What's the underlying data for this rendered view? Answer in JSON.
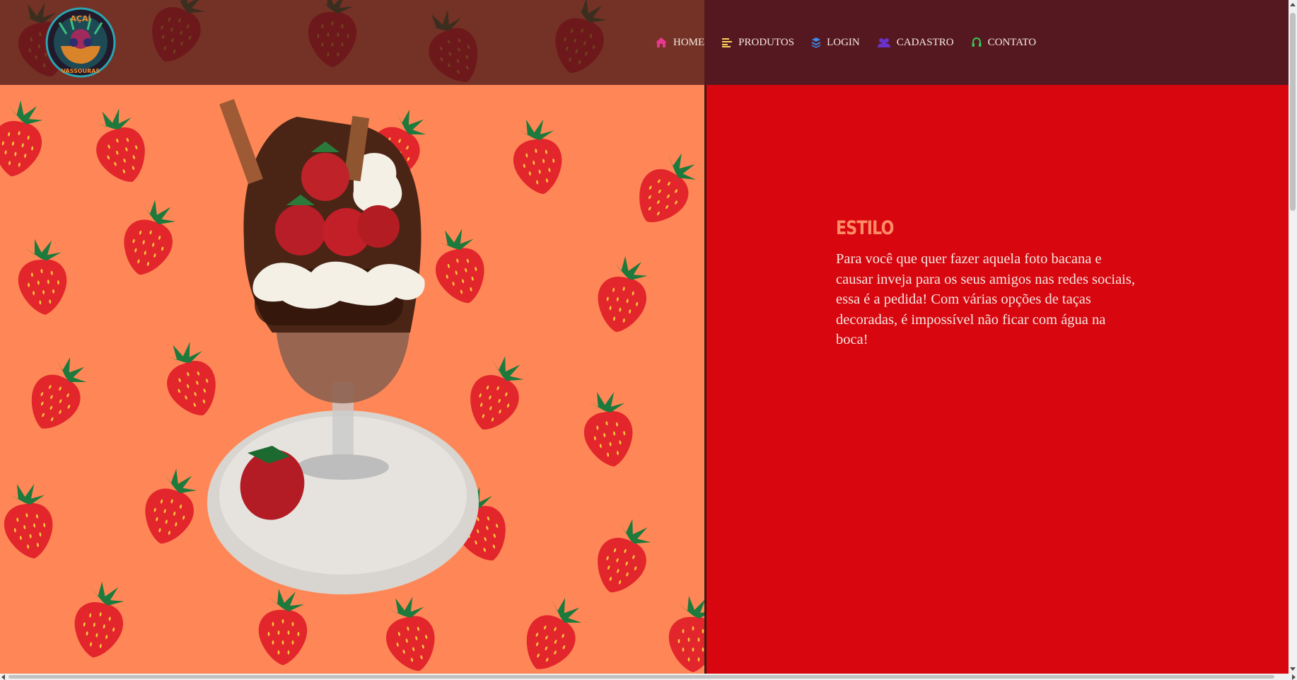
{
  "brand": {
    "logo_icon": "acai-bowl-logo",
    "logo_top_text": "AÇAÍ",
    "logo_bottom_text": "VASSOURAS"
  },
  "nav": {
    "items": [
      {
        "label": "HOME",
        "icon": "home-icon",
        "icon_color": "#e8378c"
      },
      {
        "label": "PRODUTOS",
        "icon": "list-icon",
        "icon_color": "#f4d35e"
      },
      {
        "label": "LOGIN",
        "icon": "layers-icon",
        "icon_color": "#3a8df0"
      },
      {
        "label": "CADASTRO",
        "icon": "users-icon",
        "icon_color": "#6a32c8"
      },
      {
        "label": "CONTATO",
        "icon": "headset-icon",
        "icon_color": "#34c759"
      }
    ]
  },
  "hero": {
    "image": "chocolate-acai-sundae-with-strawberries",
    "background_color": "#ff8757"
  },
  "section": {
    "title": "ESTILO",
    "body": "Para você que quer fazer aquela foto bacana e causar inveja para os seus amigos nas redes sociais, essa é a pedida! Com várias opções de taças decoradas, é impossível não ficar com água na boca!",
    "title_color": "#ff8c66",
    "background_color": "#d7060f"
  }
}
